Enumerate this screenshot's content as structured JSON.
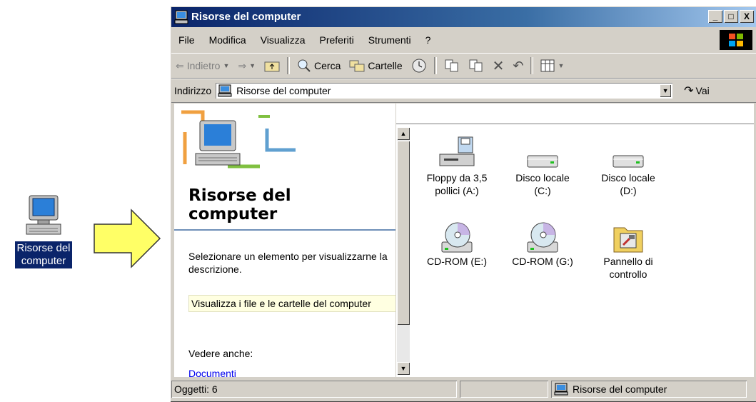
{
  "desktop": {
    "icon_label_line1": "Risorse del",
    "icon_label_line2": "computer"
  },
  "window": {
    "title": "Risorse del computer",
    "controls": {
      "minimize": "_",
      "maximize": "□",
      "close": "X"
    }
  },
  "menu": [
    "File",
    "Modifica",
    "Visualizza",
    "Preferiti",
    "Strumenti",
    "?"
  ],
  "toolbar": {
    "back": "Indietro",
    "search": "Cerca",
    "folders": "Cartelle"
  },
  "address": {
    "label": "Indirizzo",
    "value": "Risorse del computer",
    "go": "Vai"
  },
  "left_panel": {
    "title_line1": "Risorse del",
    "title_line2": "computer",
    "description": "Selezionare un elemento per visualizzarne la descrizione.",
    "hint": "Visualizza i file e le cartelle del computer",
    "see_also": "Vedere anche:",
    "link": "Documenti"
  },
  "items": [
    {
      "label1": "Floppy da 3,5",
      "label2": "pollici (A:)",
      "icon": "floppy-icon"
    },
    {
      "label1": "Disco locale",
      "label2": "(C:)",
      "icon": "disk-icon"
    },
    {
      "label1": "Disco locale",
      "label2": "(D:)",
      "icon": "disk-icon"
    },
    {
      "label1": "CD-ROM (E:)",
      "label2": "",
      "icon": "cdrom-icon"
    },
    {
      "label1": "CD-ROM (G:)",
      "label2": "",
      "icon": "cdrom-icon"
    },
    {
      "label1": "Pannello di",
      "label2": "controllo",
      "icon": "control-panel-icon"
    }
  ],
  "status": {
    "objects": "Oggetti: 6",
    "location": "Risorse del computer"
  },
  "colors": {
    "titlebar_start": "#0a246a",
    "titlebar_end": "#a6caf0",
    "face": "#d4d0c8",
    "link": "#0000ee"
  }
}
